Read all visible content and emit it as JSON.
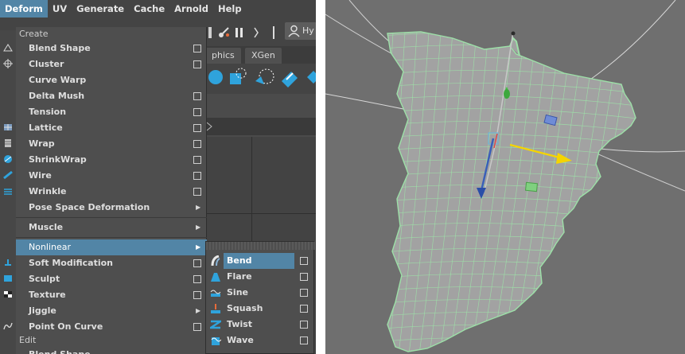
{
  "menubar": {
    "items": [
      "Deform",
      "UV",
      "Generate",
      "Cache",
      "Arnold",
      "Help"
    ],
    "active_index": 0
  },
  "background_ui": {
    "tab_graphics": "phics",
    "tab_xgen": "XGen",
    "user_label": "Hy"
  },
  "deform_menu": {
    "section_create": "Create",
    "items": [
      {
        "label": "Blend Shape",
        "options_box": true
      },
      {
        "label": "Cluster",
        "options_box": true
      },
      {
        "label": "Curve Warp",
        "options_box": false
      },
      {
        "label": "Delta Mush",
        "options_box": true
      },
      {
        "label": "Tension",
        "options_box": true
      },
      {
        "label": "Lattice",
        "options_box": true
      },
      {
        "label": "Wrap",
        "options_box": true
      },
      {
        "label": "ShrinkWrap",
        "options_box": true
      },
      {
        "label": "Wire",
        "options_box": true
      },
      {
        "label": "Wrinkle",
        "options_box": true
      },
      {
        "label": "Pose Space Deformation",
        "submenu": true
      }
    ],
    "muscle": {
      "label": "Muscle",
      "submenu": true
    },
    "nonlinear": {
      "label": "Nonlinear",
      "submenu": true
    },
    "items2": [
      {
        "label": "Soft Modification",
        "options_box": true
      },
      {
        "label": "Sculpt",
        "options_box": true
      },
      {
        "label": "Texture",
        "options_box": true
      },
      {
        "label": "Jiggle",
        "submenu": true
      },
      {
        "label": "Point On Curve",
        "options_box": true
      }
    ],
    "section_edit": "Edit",
    "partial_item": "Blend Shape"
  },
  "nonlinear_submenu": {
    "items": [
      {
        "label": "Bend",
        "icon": "bend-icon",
        "highlighted": true
      },
      {
        "label": "Flare",
        "icon": "flare-icon"
      },
      {
        "label": "Sine",
        "icon": "sine-icon"
      },
      {
        "label": "Squash",
        "icon": "squash-icon"
      },
      {
        "label": "Twist",
        "icon": "twist-icon"
      },
      {
        "label": "Wave",
        "icon": "wave-icon"
      }
    ]
  },
  "colors": {
    "highlight": "#5285a6",
    "menu_bg": "#4e4e4e",
    "viewport_bg": "#6f6f6f",
    "mesh_wire": "#9de0a8",
    "mesh_fill": "#a2a2a2"
  }
}
